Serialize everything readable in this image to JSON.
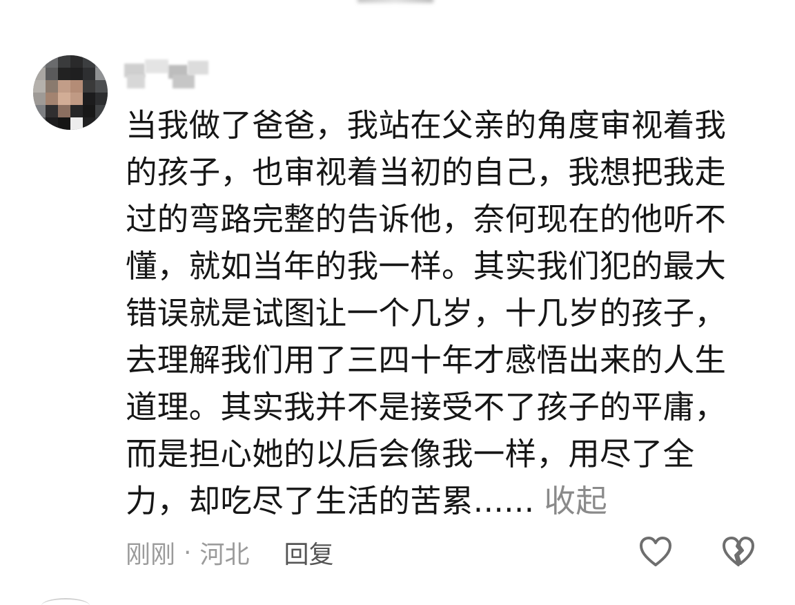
{
  "comment": {
    "text": "当我做了爸爸，我站在父亲的角度审视着我的孩子，也审视着当初的自己，我想把我走过的弯路完整的告诉他，奈何现在的他听不懂，就如当年的我一样。其实我们犯的最大错误就是试图让一个几岁，十几岁的孩子，去理解我们用了三四十年才感悟出来的人生道理。其实我并不是接受不了孩子的平庸，而是担心她的以后会像我一样，用尽了全力，却吃尽了生活的苦累......",
    "collapse_label": "收起",
    "time": "刚刚",
    "separator": "·",
    "location": "河北",
    "reply_label": "回复"
  },
  "icons": {
    "like": "heart-outline-icon",
    "dislike": "broken-heart-icon"
  },
  "colors": {
    "text": "#161616",
    "meta": "#9b9b9b",
    "reply": "#555555",
    "icon": "#6e6e6e"
  }
}
